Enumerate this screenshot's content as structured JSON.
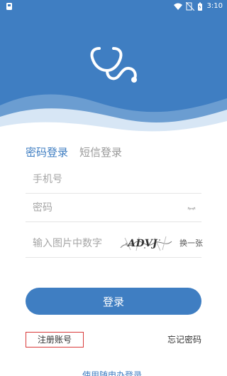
{
  "status_bar": {
    "time": "3:10"
  },
  "login_tabs": [
    {
      "label": "密码登录",
      "active": true
    },
    {
      "label": "短信登录",
      "active": false
    }
  ],
  "form": {
    "phone_placeholder": "手机号",
    "password_placeholder": "密码",
    "captcha_placeholder": "输入图片中数字",
    "captcha_text": "ADVJ",
    "refresh_captcha": "换一张"
  },
  "actions": {
    "login_label": "登录",
    "register_label": "注册账号",
    "forgot_password_label": "忘记密码",
    "bottom_link_label": "使用随申办登录"
  },
  "colors": {
    "primary": "#3f7ec2",
    "white": "#ffffff",
    "input_border": "#e5e5e5",
    "placeholder": "#a6a6a6",
    "highlight_border": "#d93a3a"
  },
  "icons": {
    "logo": "stethoscope-logo-icon",
    "eye": "password-visibility-icon"
  }
}
